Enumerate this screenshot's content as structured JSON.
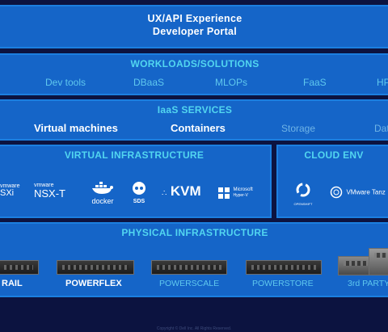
{
  "portal": {
    "line1": "UX/API Experience",
    "line2": "Developer Portal"
  },
  "workloads": {
    "title": "WORKLOADS/SOLUTIONS",
    "items": [
      "Dev tools",
      "DBaaS",
      "MLOPs",
      "FaaS",
      "HP"
    ]
  },
  "iaas": {
    "title": "IaaS SERVICES",
    "items": [
      "Virtual machines",
      "Containers",
      "Storage",
      "Dat"
    ]
  },
  "virtual_infra": {
    "title": "VIRTUAL INFRASTRUCTURE",
    "logos": {
      "esxi_a": "vmware",
      "esxi_b": "SXi",
      "nsx_a": "vmware",
      "nsx_b": "NSX-T",
      "docker": "docker",
      "sds": "SDS",
      "kvm": "KVM",
      "hyperv_a": "Microsoft",
      "hyperv_b": "Hyper-V"
    }
  },
  "cloud_env": {
    "title": "CLOUD ENV",
    "logos": {
      "openshift": "OPENSHIFT",
      "tanzu": "VMware Tanz"
    }
  },
  "physical": {
    "title": "PHYSICAL INFRASTRUCTURE",
    "items": [
      "RAIL",
      "POWERFLEX",
      "POWERSCALE",
      "POWERSTORE",
      "3rd PARTY"
    ]
  },
  "footer": "Copyright © Dell Inc. All Rights Reserved.",
  "colors": {
    "background": "#0c1340",
    "band": "#1565c8",
    "border": "#1c7fe0",
    "title_accent": "#52d6f0"
  }
}
